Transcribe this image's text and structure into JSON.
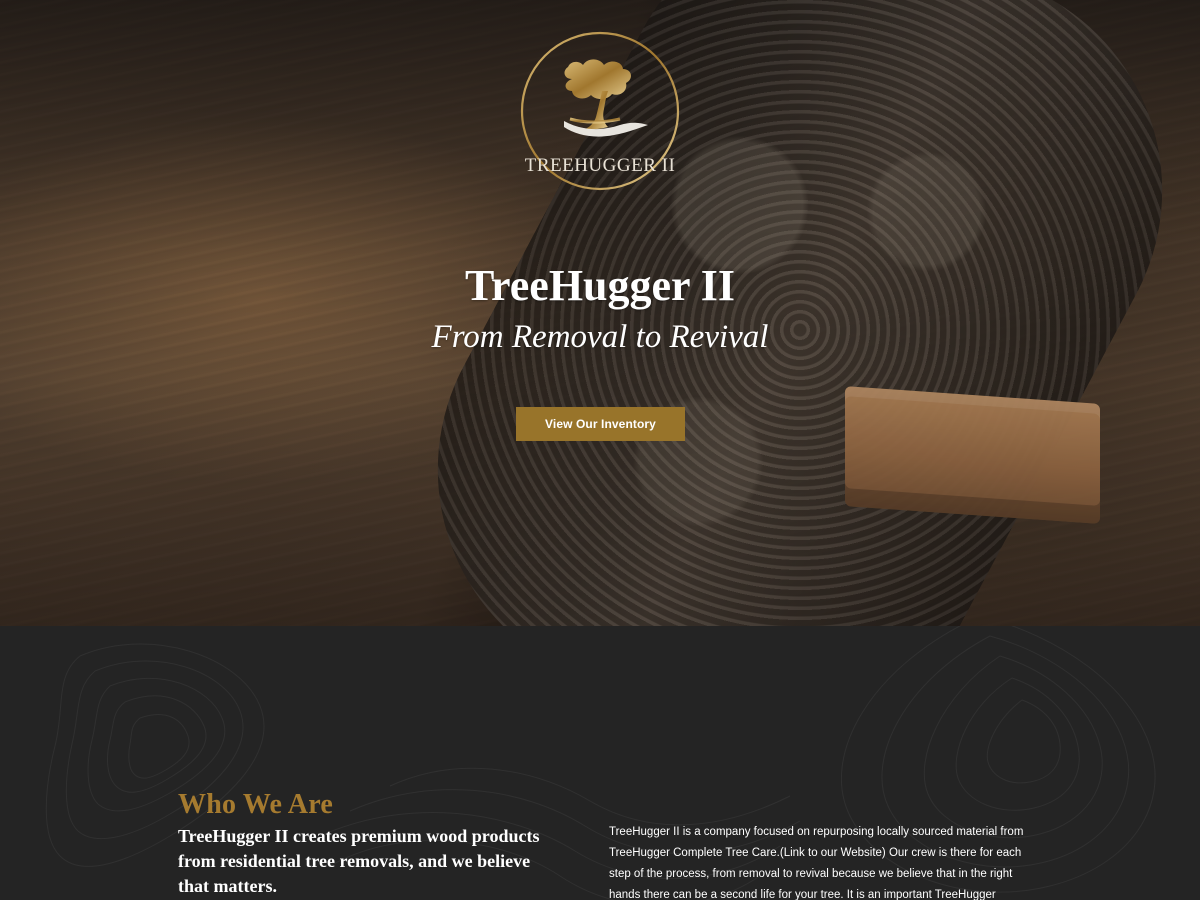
{
  "brand": {
    "logo_text": "TREEHUGGER II",
    "logo_gold": "#9a742d"
  },
  "hero": {
    "title": "TreeHugger II",
    "subtitle": "From Removal to Revival",
    "cta_label": "View Our Inventory",
    "cta_color": "#98742a"
  },
  "about": {
    "heading": "Who We Are",
    "heading_color": "#a67b2f",
    "lead": "TreeHugger II creates premium wood products from residential tree removals, and we believe that matters.",
    "body": "TreeHugger II is a company focused on repurposing locally sourced material from TreeHugger Complete Tree Care.(Link to our Website) Our crew is there for each step of the process, from removal to revival because we believe that in the right hands there can be a second life for your tree. It is an important TreeHugger"
  },
  "theme": {
    "dark_bg": "#242424",
    "text": "#ffffff"
  }
}
